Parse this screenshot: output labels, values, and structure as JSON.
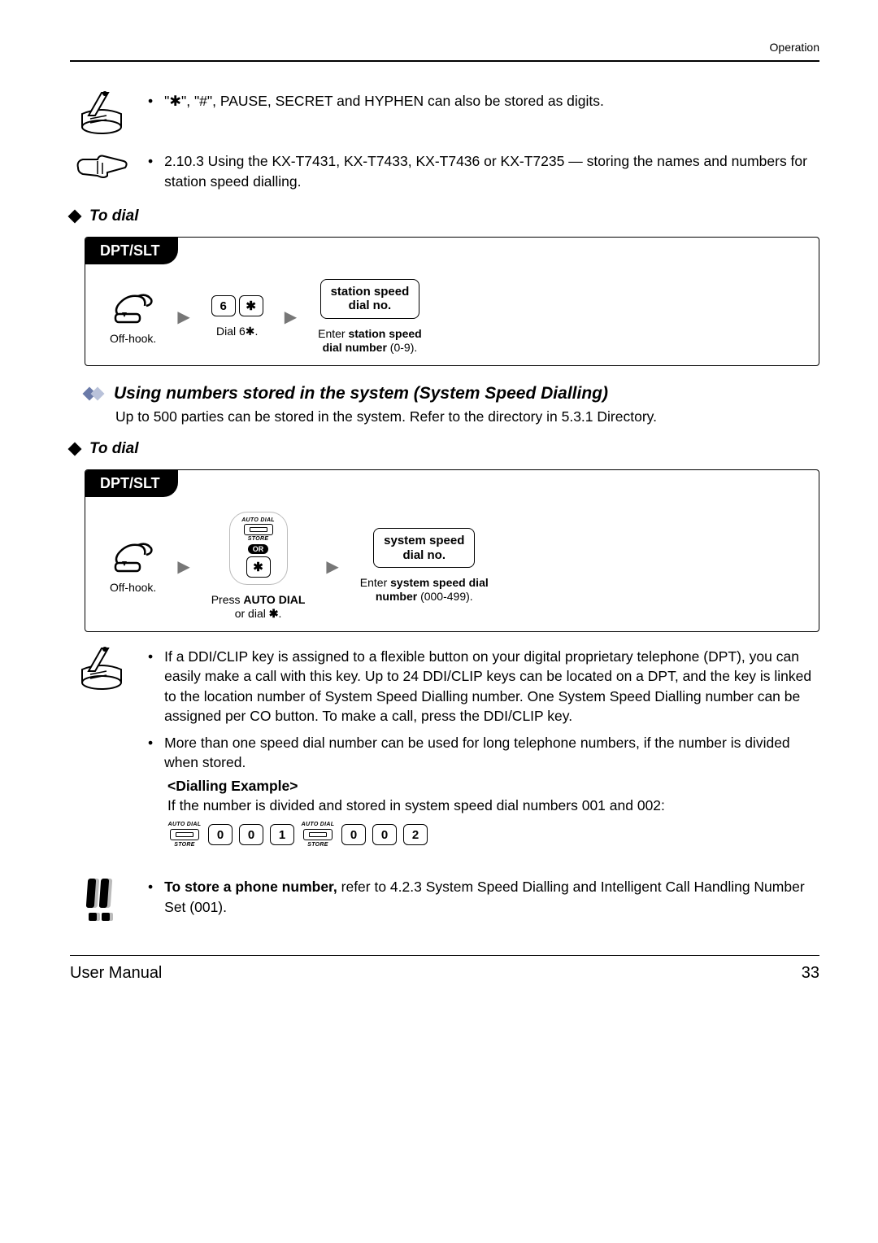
{
  "header": {
    "section": "Operation"
  },
  "note1": {
    "text": "\"✱\", \"#\", PAUSE, SECRET and HYPHEN can also be stored as digits."
  },
  "ref1": {
    "text": "2.10.3   Using the KX-T7431, KX-T7433, KX-T7436 or KX-T7235 — storing the names and numbers for station speed dialling."
  },
  "todial": "To dial",
  "proc1": {
    "tab": "DPT/SLT",
    "step1": "Off-hook.",
    "key1": "6",
    "key2": "✱",
    "step2": "Dial 6✱.",
    "input_l1": "station speed",
    "input_l2": "dial no.",
    "step3_l1": "Enter station speed",
    "step3_l2": "dial number (0-9)."
  },
  "sub1": {
    "title": "Using numbers stored in the system (System Speed Dialling)",
    "desc": "Up to 500 parties can be stored in the system. Refer to the directory in 5.3.1   Directory."
  },
  "proc2": {
    "tab": "DPT/SLT",
    "step1": "Off-hook.",
    "ad_top": "AUTO DIAL",
    "ad_bot": "STORE",
    "or": "OR",
    "key_star": "✱",
    "step2_l1": "Press AUTO DIAL",
    "step2_l2": "or dial ✱.",
    "input_l1": "system speed",
    "input_l2": "dial no.",
    "step3_l1": "Enter system speed dial",
    "step3_l2": "number (000-499)."
  },
  "note2": {
    "b1": "If a DDI/CLIP key is assigned to a flexible button on your digital proprietary telephone (DPT), you can easily make a call with this key. Up to 24 DDI/CLIP keys can be located on a DPT, and the key is linked to the location number of System Speed Dialling number. One System Speed Dialling number can be assigned per CO button. To make a call, press the DDI/CLIP key.",
    "b2": "More than one speed dial number can be used for long telephone numbers, if the number is divided when stored.",
    "ex_title": "<Dialling Example>",
    "ex_text": "If the number is divided and stored in system speed dial numbers 001 and 002:",
    "keys1": [
      "0",
      "0",
      "1"
    ],
    "keys2": [
      "0",
      "0",
      "2"
    ]
  },
  "warn1": {
    "bold": "To store a phone number,",
    "rest": " refer to 4.2.3   System Speed Dialling and Intelligent Call Handling Number Set (001)."
  },
  "footer": {
    "left": "User Manual",
    "right": "33"
  }
}
